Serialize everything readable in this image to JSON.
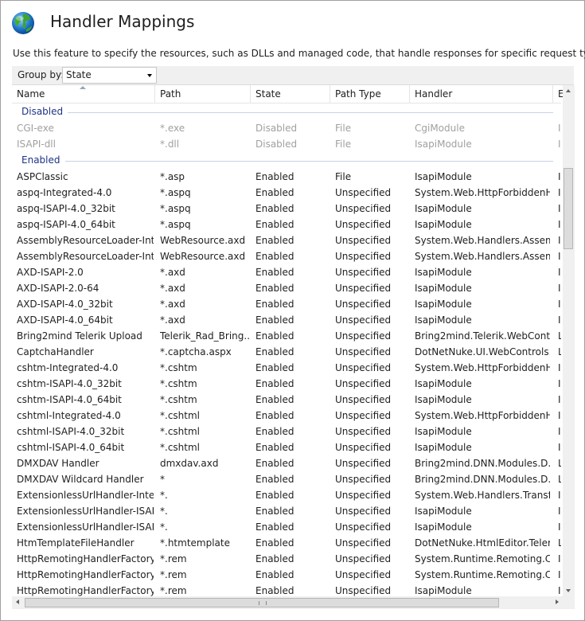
{
  "title": "Handler Mappings",
  "description": "Use this feature to specify the resources, such as DLLs and managed code, that handle responses for specific request types.",
  "toolbar": {
    "group_by_label": "Group by:",
    "group_by_value": "State"
  },
  "columns": [
    "Name",
    "Path",
    "State",
    "Path Type",
    "Handler",
    "E"
  ],
  "groups": [
    {
      "label": "Disabled",
      "rows": [
        [
          "CGI-exe",
          "*.exe",
          "Disabled",
          "File",
          "CgiModule",
          "I"
        ],
        [
          "ISAPI-dll",
          "*.dll",
          "Disabled",
          "File",
          "IsapiModule",
          "I"
        ]
      ]
    },
    {
      "label": "Enabled",
      "rows": [
        [
          "ASPClassic",
          "*.asp",
          "Enabled",
          "File",
          "IsapiModule",
          "I"
        ],
        [
          "aspq-Integrated-4.0",
          "*.aspq",
          "Enabled",
          "Unspecified",
          "System.Web.HttpForbiddenH...",
          "I"
        ],
        [
          "aspq-ISAPI-4.0_32bit",
          "*.aspq",
          "Enabled",
          "Unspecified",
          "IsapiModule",
          "I"
        ],
        [
          "aspq-ISAPI-4.0_64bit",
          "*.aspq",
          "Enabled",
          "Unspecified",
          "IsapiModule",
          "I"
        ],
        [
          "AssemblyResourceLoader-Inte...",
          "WebResource.axd",
          "Enabled",
          "Unspecified",
          "System.Web.Handlers.Assem...",
          "I"
        ],
        [
          "AssemblyResourceLoader-Inte...",
          "WebResource.axd",
          "Enabled",
          "Unspecified",
          "System.Web.Handlers.Assem...",
          "I"
        ],
        [
          "AXD-ISAPI-2.0",
          "*.axd",
          "Enabled",
          "Unspecified",
          "IsapiModule",
          "I"
        ],
        [
          "AXD-ISAPI-2.0-64",
          "*.axd",
          "Enabled",
          "Unspecified",
          "IsapiModule",
          "I"
        ],
        [
          "AXD-ISAPI-4.0_32bit",
          "*.axd",
          "Enabled",
          "Unspecified",
          "IsapiModule",
          "I"
        ],
        [
          "AXD-ISAPI-4.0_64bit",
          "*.axd",
          "Enabled",
          "Unspecified",
          "IsapiModule",
          "I"
        ],
        [
          "Bring2mind Telerik Upload",
          "Telerik_Rad_Bring...",
          "Enabled",
          "Unspecified",
          "Bring2mind.Telerik.WebContr...",
          "L"
        ],
        [
          "CaptchaHandler",
          "*.captcha.aspx",
          "Enabled",
          "Unspecified",
          "DotNetNuke.UI.WebControls....",
          "L"
        ],
        [
          "cshtm-Integrated-4.0",
          "*.cshtm",
          "Enabled",
          "Unspecified",
          "System.Web.HttpForbiddenH...",
          "I"
        ],
        [
          "cshtm-ISAPI-4.0_32bit",
          "*.cshtm",
          "Enabled",
          "Unspecified",
          "IsapiModule",
          "I"
        ],
        [
          "cshtm-ISAPI-4.0_64bit",
          "*.cshtm",
          "Enabled",
          "Unspecified",
          "IsapiModule",
          "I"
        ],
        [
          "cshtml-Integrated-4.0",
          "*.cshtml",
          "Enabled",
          "Unspecified",
          "System.Web.HttpForbiddenH...",
          "I"
        ],
        [
          "cshtml-ISAPI-4.0_32bit",
          "*.cshtml",
          "Enabled",
          "Unspecified",
          "IsapiModule",
          "I"
        ],
        [
          "cshtml-ISAPI-4.0_64bit",
          "*.cshtml",
          "Enabled",
          "Unspecified",
          "IsapiModule",
          "I"
        ],
        [
          "DMXDAV Handler",
          "dmxdav.axd",
          "Enabled",
          "Unspecified",
          "Bring2mind.DNN.Modules.D...",
          "L"
        ],
        [
          "DMXDAV Wildcard Handler",
          "*",
          "Enabled",
          "Unspecified",
          "Bring2mind.DNN.Modules.D...",
          "L"
        ],
        [
          "ExtensionlessUrlHandler-Integ...",
          "*.",
          "Enabled",
          "Unspecified",
          "System.Web.Handlers.Transfe...",
          "I"
        ],
        [
          "ExtensionlessUrlHandler-ISAPI...",
          "*.",
          "Enabled",
          "Unspecified",
          "IsapiModule",
          "I"
        ],
        [
          "ExtensionlessUrlHandler-ISAPI...",
          "*.",
          "Enabled",
          "Unspecified",
          "IsapiModule",
          "I"
        ],
        [
          "HtmTemplateFileHandler",
          "*.htmtemplate",
          "Enabled",
          "Unspecified",
          "DotNetNuke.HtmlEditor.Teler...",
          "L"
        ],
        [
          "HttpRemotingHandlerFactory...",
          "*.rem",
          "Enabled",
          "Unspecified",
          "System.Runtime.Remoting.C...",
          "I"
        ],
        [
          "HttpRemotingHandlerFactory...",
          "*.rem",
          "Enabled",
          "Unspecified",
          "System.Runtime.Remoting.C...",
          "I"
        ],
        [
          "HttpRemotingHandlerFactory...",
          "*.rem",
          "Enabled",
          "Unspecified",
          "IsapiModule",
          "I"
        ]
      ]
    }
  ]
}
